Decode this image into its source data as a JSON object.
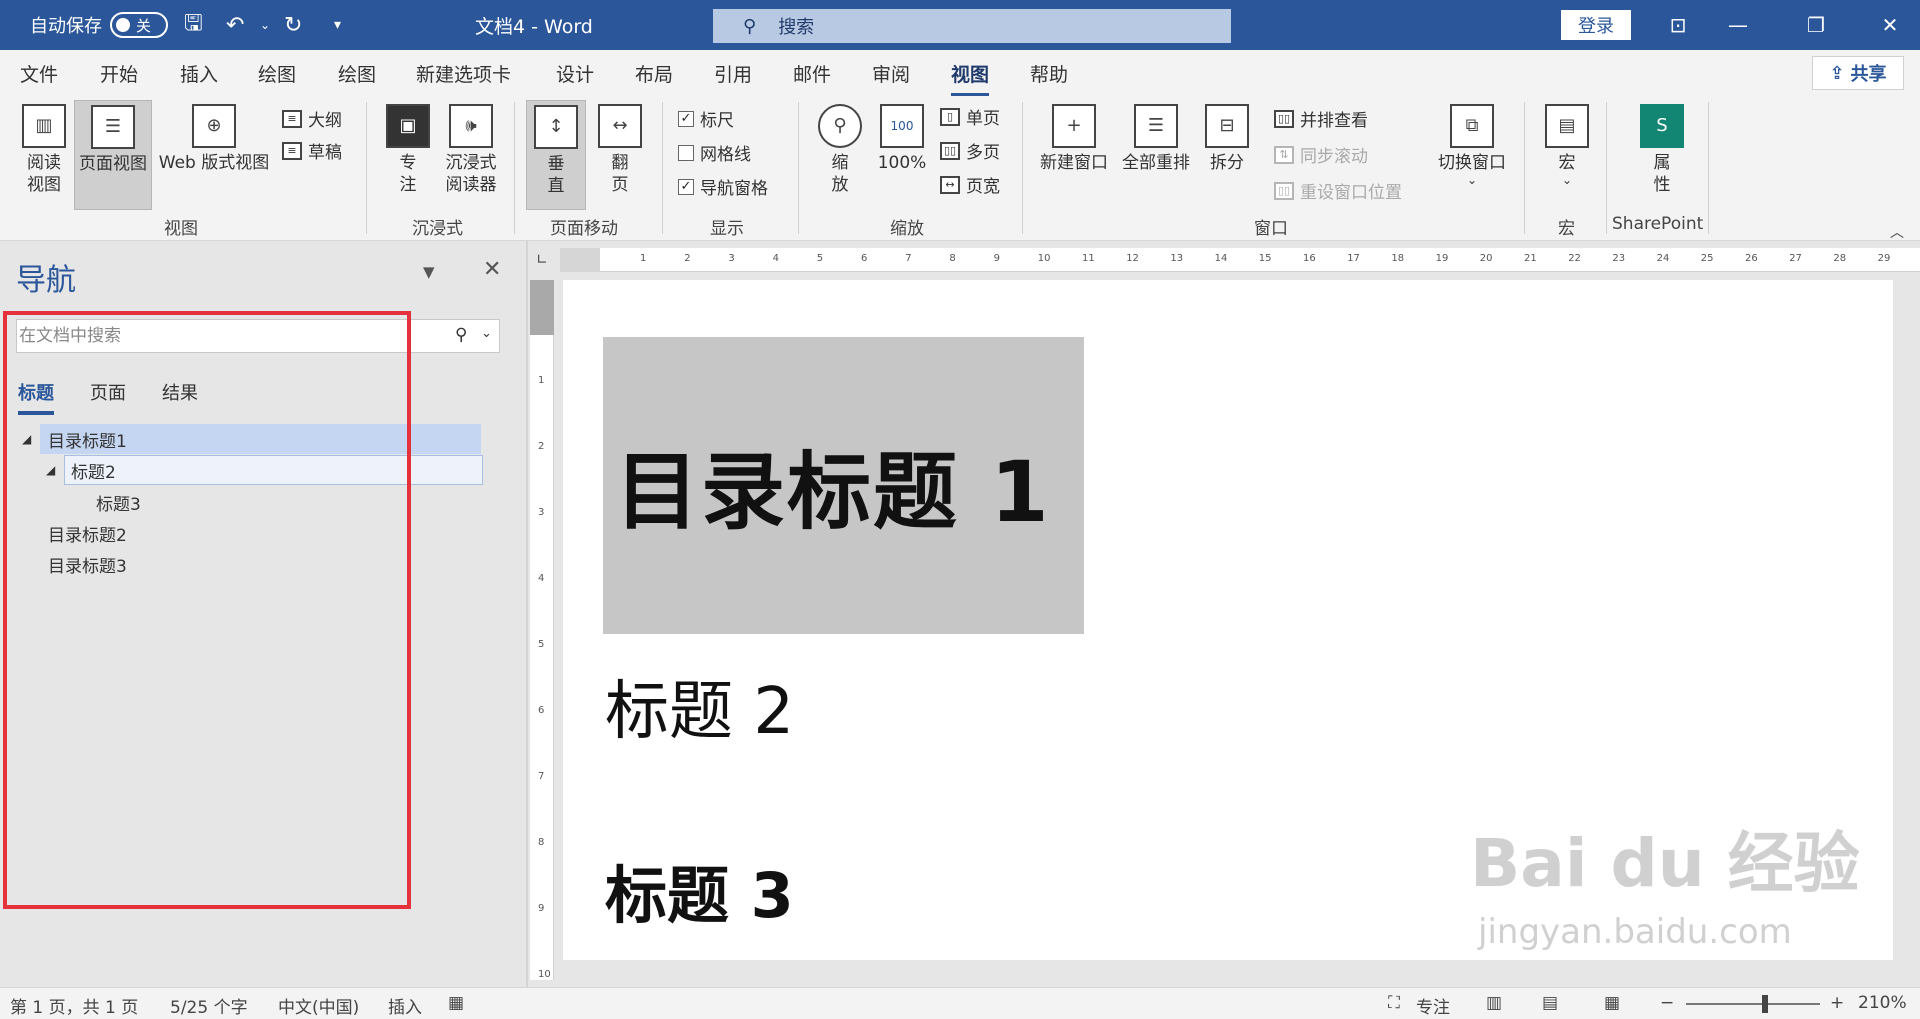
{
  "titlebar": {
    "autosave_label": "自动保存",
    "autosave_state": "关",
    "doc_title": "文档4  -  Word",
    "search_label": "搜索",
    "login_label": "登录"
  },
  "tabs": [
    "文件",
    "开始",
    "插入",
    "绘图",
    "绘图",
    "新建选项卡",
    "设计",
    "布局",
    "引用",
    "邮件",
    "审阅",
    "视图",
    "帮助"
  ],
  "share_label": "共享",
  "ribbon": {
    "views": {
      "read_mode": "阅读\n视图",
      "print_layout": "页面视图",
      "web_layout": "Web 版式视图",
      "outline": "大纲",
      "draft": "草稿",
      "label": "视图"
    },
    "immersive": {
      "focus": "专\n注",
      "reader": "沉浸式\n阅读器",
      "label": "沉浸式"
    },
    "page_movement": {
      "vertical": "垂\n直",
      "side_to_side": "翻\n页",
      "label": "页面移动"
    },
    "show": {
      "ruler": "标尺",
      "gridlines": "网格线",
      "nav_pane": "导航窗格",
      "label": "显示"
    },
    "zoom": {
      "zoom": "缩\n放",
      "hundred": "100%",
      "hundred_icon": "100",
      "one_page": "单页",
      "multi_page": "多页",
      "page_width": "页宽",
      "label": "缩放"
    },
    "window": {
      "new_window": "新建窗口",
      "arrange_all": "全部重排",
      "split": "拆分",
      "side_by_side": "并排查看",
      "sync_scroll": "同步滚动",
      "reset_position": "重设窗口位置",
      "switch_windows": "切换窗口",
      "label": "窗口"
    },
    "macros": {
      "macros": "宏",
      "label": "宏"
    },
    "sharepoint": {
      "properties": "属\n性",
      "label": "SharePoint"
    }
  },
  "nav": {
    "title": "导航",
    "search_placeholder": "在文档中搜索",
    "tabs": [
      "标题",
      "页面",
      "结果"
    ],
    "tree": [
      "目录标题1",
      "标题2",
      "标题3",
      "目录标题2",
      "目录标题3"
    ]
  },
  "document": {
    "h1": "目录标题 1",
    "h2": "标题 2",
    "h3": "标题 3"
  },
  "ruler_numbers": [
    "1",
    "2",
    "3",
    "4",
    "5",
    "6",
    "7",
    "8",
    "9",
    "10",
    "11",
    "12",
    "13",
    "14",
    "15",
    "16",
    "17",
    "18",
    "19",
    "20",
    "21",
    "22",
    "23",
    "24",
    "25",
    "26",
    "27",
    "28",
    "29"
  ],
  "watermark": {
    "line1": "Bai  du 经验",
    "line2": "jingyan.baidu.com"
  },
  "status": {
    "page": "第 1 页，共 1 页",
    "words": "5/25 个字",
    "language": "中文(中国)",
    "insert": "插入",
    "focus": "专注",
    "zoom": "210%"
  },
  "colors": {
    "accent": "#2b579a",
    "highlight_box": "#e5313c",
    "nav_selected": "#c5d6f2"
  }
}
